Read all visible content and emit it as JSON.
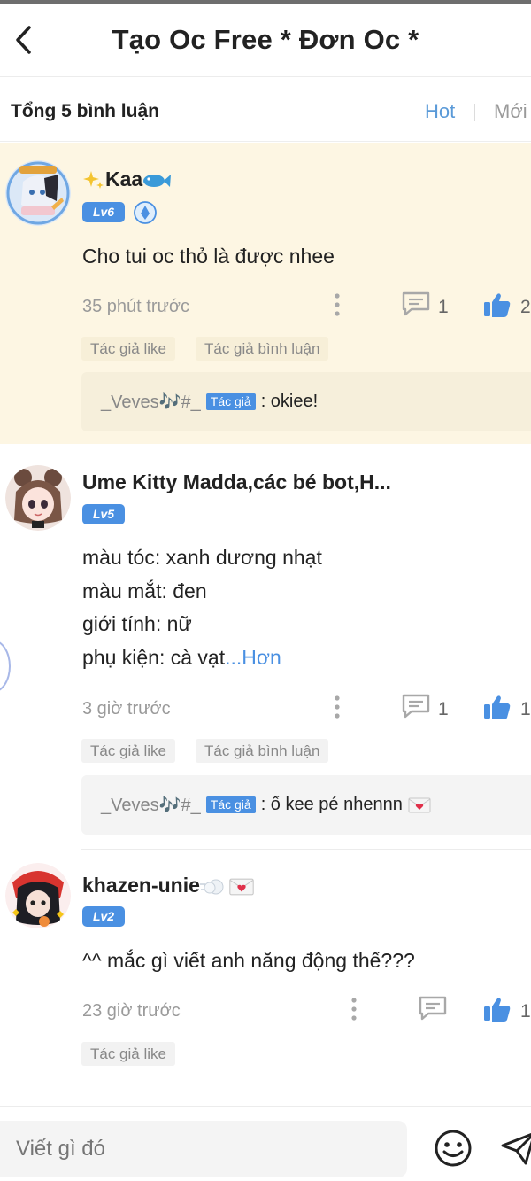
{
  "header": {
    "title": "Tạo Oc Free * Đơn Oc *"
  },
  "sortbar": {
    "total": "Tổng 5 bình luận",
    "hot": "Hot",
    "new": "Mới"
  },
  "comments": [
    {
      "name": "Kaa",
      "level": "Lv6",
      "text": "Cho tui oc thỏ là được nhee",
      "time": "35 phút trước",
      "reply_count": "1",
      "like_count": "2",
      "tags": [
        "Tác giả like",
        "Tác giả bình luận"
      ],
      "reply": {
        "user": "_Veves🎶#_",
        "badge": "Tác giả",
        "text": ": okiee!"
      }
    },
    {
      "name": "Ume Kitty Madda,các bé bot,H...",
      "level": "Lv5",
      "text_lines": [
        "màu tóc: xanh dương nhạt",
        "màu mắt: đen",
        "giới tính: nữ",
        "phụ kiện: cà vạt"
      ],
      "more": "...Hơn",
      "time": "3 giờ trước",
      "reply_count": "1",
      "like_count": "1",
      "tags": [
        "Tác giả like",
        "Tác giả bình luận"
      ],
      "reply": {
        "user": "_Veves🎶#_",
        "badge": "Tác giả",
        "text": ": ố kee pé nhennn"
      }
    },
    {
      "name": "khazen-unie",
      "level": "Lv2",
      "text": "^^ mắc gì viết anh năng động thế???",
      "time": "23 giờ trước",
      "reply_count": "",
      "like_count": "1",
      "tags": [
        "Tác giả like"
      ]
    }
  ],
  "composer": {
    "placeholder": "Viết gì đó"
  },
  "colors": {
    "accent": "#4a90e2",
    "highlight_bg": "#fdf6e3",
    "muted": "#9a9a9a"
  },
  "icons": {
    "back": "chevron-left-icon",
    "comment": "speech-bubble-icon",
    "like": "thumbs-up-icon",
    "more": "vertical-dots-icon",
    "emoji": "smiley-icon",
    "send": "paper-plane-icon"
  }
}
